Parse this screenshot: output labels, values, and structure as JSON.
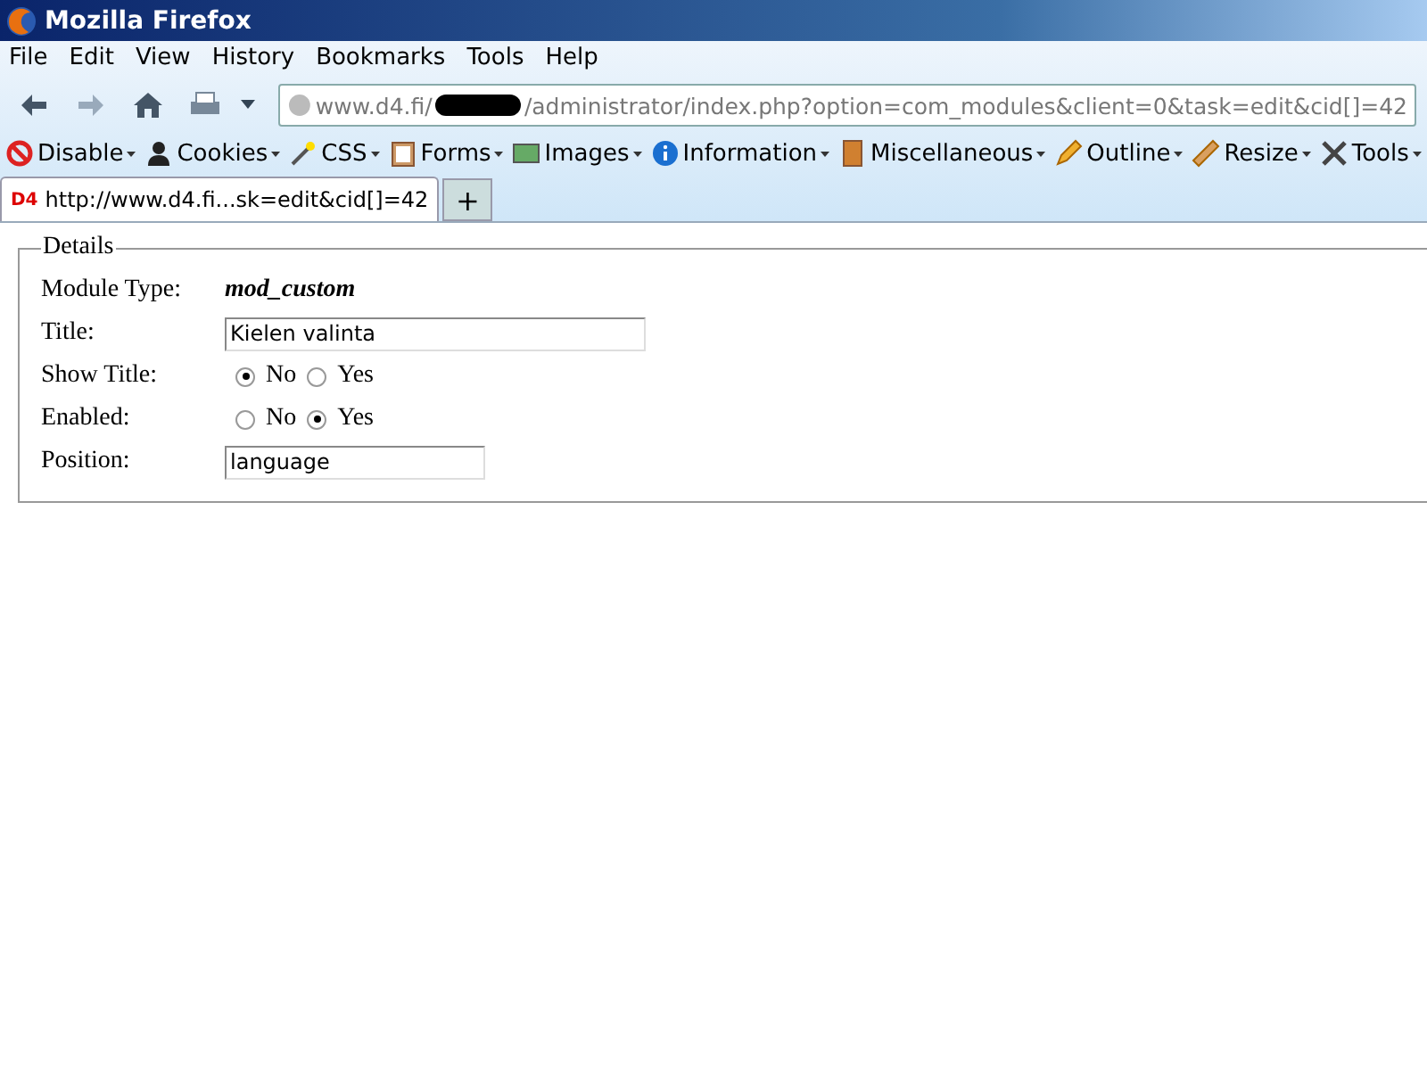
{
  "window": {
    "title": "Mozilla Firefox"
  },
  "menu": [
    "File",
    "Edit",
    "View",
    "History",
    "Bookmarks",
    "Tools",
    "Help"
  ],
  "address": {
    "before": "www.d4.fi/",
    "after": "/administrator/index.php?option=com_modules&client=0&task=edit&cid[]=42"
  },
  "toolbar": [
    "Disable",
    "Cookies",
    "CSS",
    "Forms",
    "Images",
    "Information",
    "Miscellaneous",
    "Outline",
    "Resize",
    "Tools"
  ],
  "tabs": [
    {
      "favicon": "D4",
      "label": "http://www.d4.fi...sk=edit&cid[]=42",
      "selected": true
    }
  ],
  "new_tab": "+",
  "form": {
    "legend": "Details",
    "rows": [
      {
        "label": "Module Type:",
        "kind": "text",
        "value": "mod_custom"
      },
      {
        "label": "Title:",
        "kind": "field",
        "value": "Kielen valinta"
      },
      {
        "label": "Show Title:",
        "kind": "radio",
        "options": [
          {
            "label": "No",
            "selected": true
          },
          {
            "label": "Yes",
            "selected": false
          }
        ]
      },
      {
        "label": "Enabled:",
        "kind": "radio",
        "options": [
          {
            "label": "No",
            "selected": false
          },
          {
            "label": "Yes",
            "selected": true
          }
        ]
      },
      {
        "label": "Position:",
        "kind": "field",
        "value": "language"
      }
    ]
  }
}
